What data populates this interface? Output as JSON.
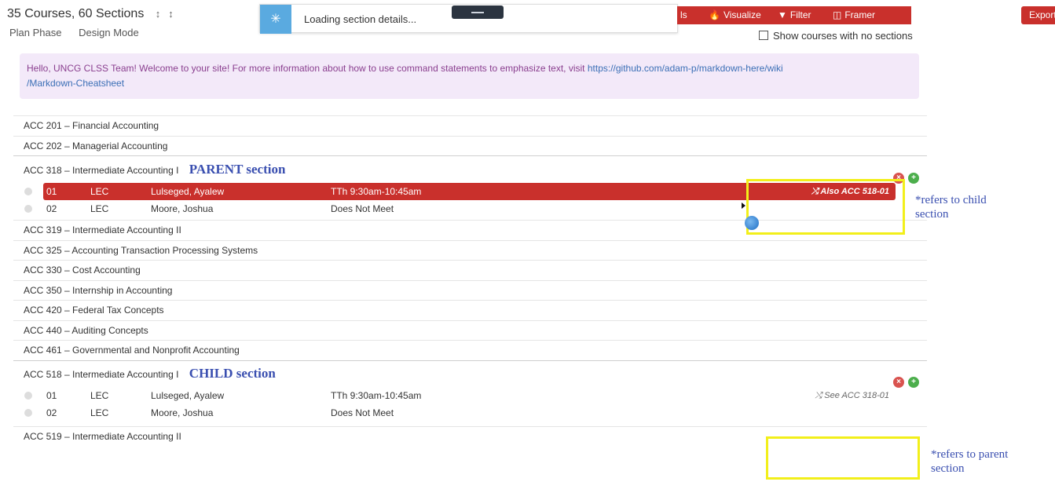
{
  "header": {
    "title": "35 Courses, 60 Sections",
    "sort_up_icon": "↕",
    "sort_down_icon": "↕",
    "plan_phase": "Plan Phase",
    "design_mode": "Design Mode"
  },
  "loading": {
    "text": "Loading section details..."
  },
  "toolbar": {
    "stub_label": "ls",
    "visualize_label": "Visualize",
    "filter_label": "Filter",
    "framer_label": "Framer",
    "export_label": "Export ▾",
    "visualize_icon": "🔥",
    "filter_icon": "▼",
    "framer_icon": "◫"
  },
  "show_courses_label": "Show courses with no sections",
  "banner": {
    "text": "Hello, UNCG CLSS Team! Welcome to your site! For more information about how to use command statements to emphasize text, visit ",
    "link1": "https://github.com/adam-p/markdown-here/wiki",
    "link2": "/Markdown-Cheatsheet"
  },
  "courses": [
    {
      "title": "ACC 201 – Financial Accounting"
    },
    {
      "title": "ACC 202 – Managerial Accounting"
    },
    {
      "title": "ACC 318 – Intermediate Accounting I",
      "annotation": "PARENT section"
    },
    {
      "title": "ACC 319 – Intermediate Accounting II"
    },
    {
      "title": "ACC 325 – Accounting Transaction Processing Systems"
    },
    {
      "title": "ACC 330 – Cost Accounting"
    },
    {
      "title": "ACC 350 – Internship in Accounting"
    },
    {
      "title": "ACC 420 – Federal Tax Concepts"
    },
    {
      "title": "ACC 440 – Auditing Concepts"
    },
    {
      "title": "ACC 461 – Governmental and Nonprofit Accounting"
    },
    {
      "title": "ACC 518 – Intermediate Accounting I",
      "annotation": "CHILD section"
    },
    {
      "title": "ACC 519 – Intermediate Accounting II"
    }
  ],
  "sections_318": [
    {
      "num": "01",
      "type": "LEC",
      "instructor": "Lulseged, Ayalew",
      "time": "TTh 9:30am-10:45am",
      "cross": "⤭ Also ACC 518-01"
    },
    {
      "num": "02",
      "type": "LEC",
      "instructor": "Moore, Joshua",
      "time": "Does Not Meet"
    }
  ],
  "sections_518": [
    {
      "num": "01",
      "type": "LEC",
      "instructor": "Lulseged, Ayalew",
      "time": "TTh 9:30am-10:45am",
      "cross": "⤭ See ACC 318-01"
    },
    {
      "num": "02",
      "type": "LEC",
      "instructor": "Moore, Joshua",
      "time": "Does Not Meet"
    }
  ],
  "annotations": {
    "child_ref": [
      "*refers to child",
      "section"
    ],
    "parent_ref": [
      "*refers to parent",
      "section"
    ]
  },
  "colors": {
    "accent_red": "#c9302c",
    "annotation_blue": "#3a4fb0",
    "highlight_yellow": "#f2ef1a"
  },
  "icons": {
    "remove": "×",
    "add": "+"
  }
}
